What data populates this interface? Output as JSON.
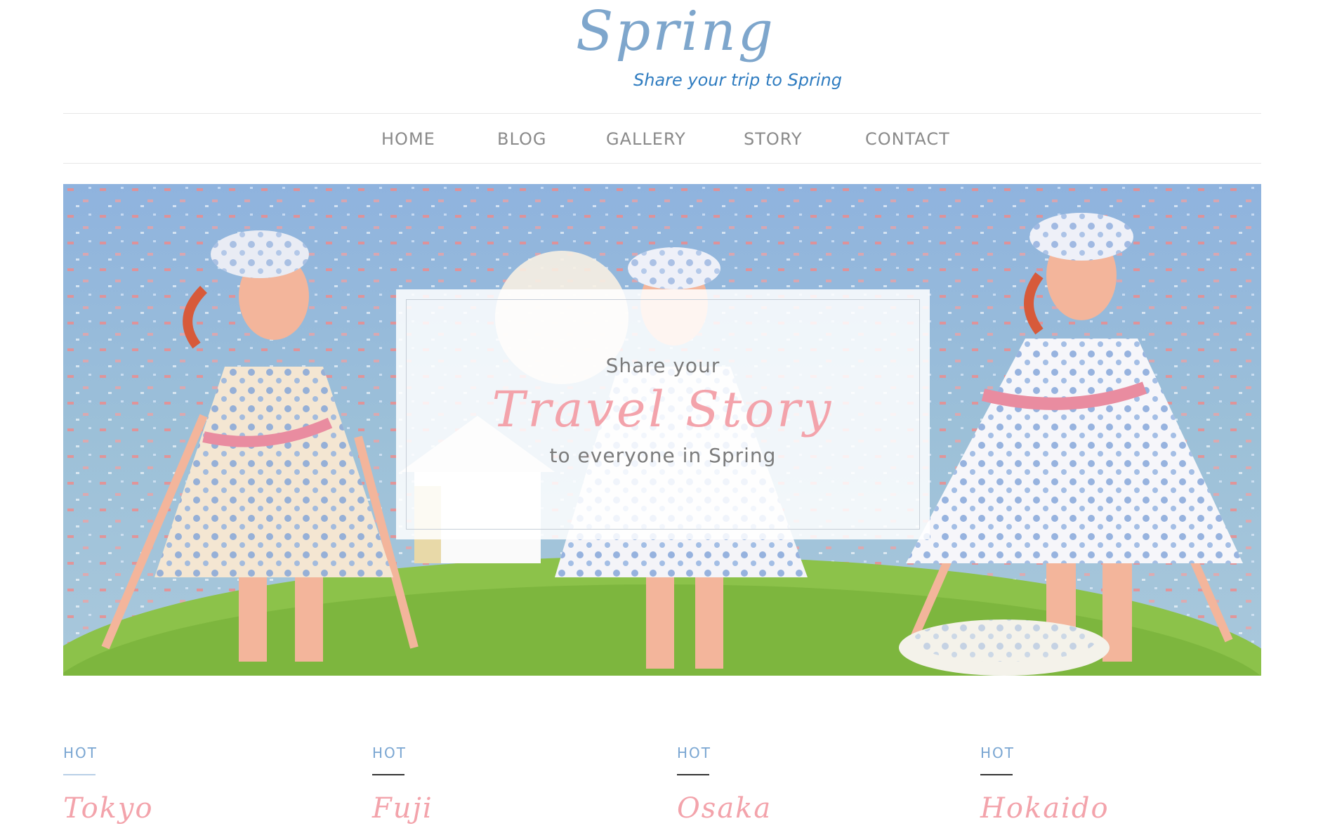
{
  "site": {
    "logo": "Spring",
    "tagline": "Share your trip to Spring"
  },
  "nav": {
    "items": [
      "HOME",
      "BLOG",
      "GALLERY",
      "STORY",
      "CONTACT"
    ]
  },
  "hero": {
    "line1": "Share your",
    "line2": "Travel Story",
    "line3": "to everyone in Spring"
  },
  "cards": [
    {
      "badge": "HOT",
      "title": "Tokyo"
    },
    {
      "badge": "HOT",
      "title": "Fuji"
    },
    {
      "badge": "HOT",
      "title": "Osaka"
    },
    {
      "badge": "HOT",
      "title": "Hokaido"
    }
  ],
  "colors": {
    "logo": "#7ea6cc",
    "tagline": "#2f7cc0",
    "accent_pink": "#f3a3ab",
    "badge_blue": "#7aa6d2",
    "nav_text": "#8a8a8a"
  }
}
